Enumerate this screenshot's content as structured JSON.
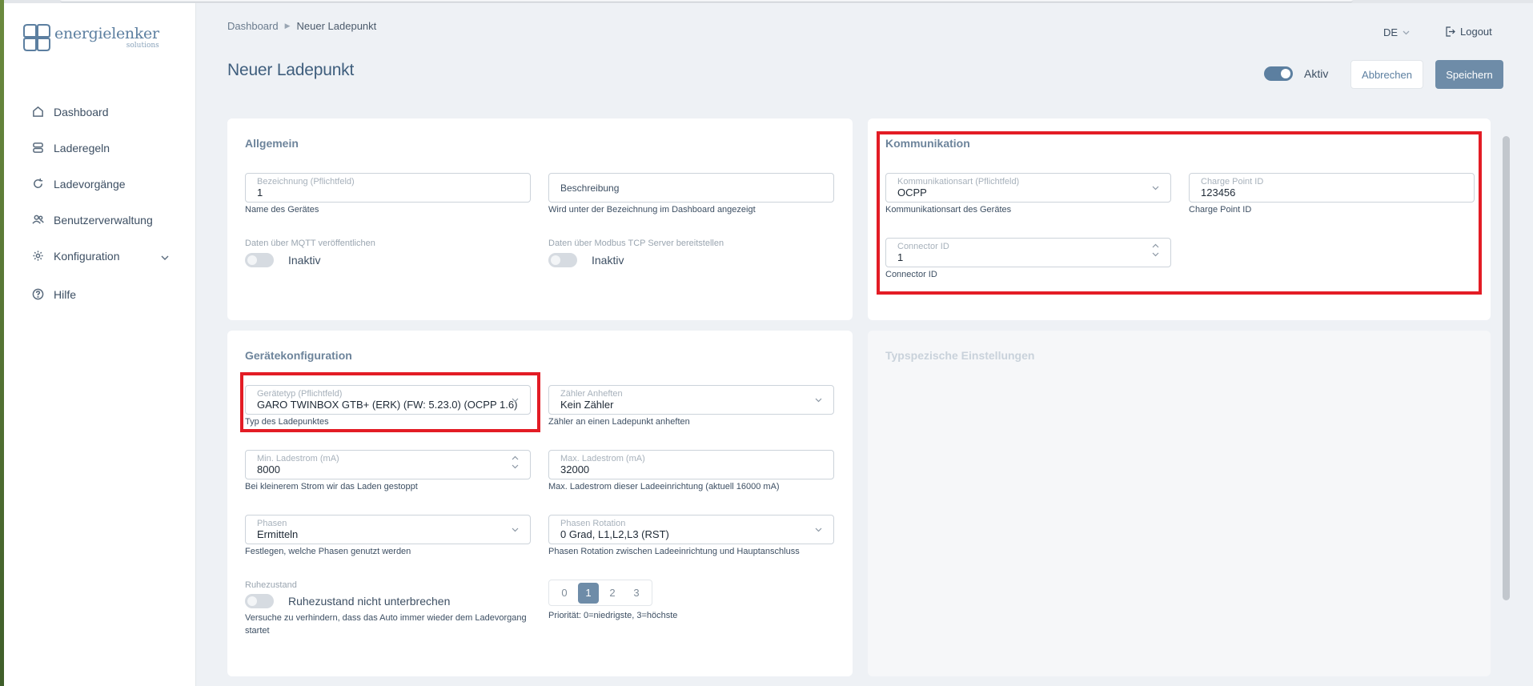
{
  "brand": {
    "name": "energielenker",
    "sub": "solutions"
  },
  "nav": {
    "items": [
      {
        "label": "Dashboard",
        "icon": "home-icon"
      },
      {
        "label": "Laderegeln",
        "icon": "server-icon"
      },
      {
        "label": "Ladevorgänge",
        "icon": "refresh-icon"
      },
      {
        "label": "Benutzerverwaltung",
        "icon": "users-icon"
      },
      {
        "label": "Konfiguration",
        "icon": "gear-icon"
      },
      {
        "label": "Hilfe",
        "icon": "help-icon"
      }
    ]
  },
  "breadcrumb": {
    "root": "Dashboard",
    "current": "Neuer Ladepunkt"
  },
  "page": {
    "title": "Neuer Ladepunkt"
  },
  "header": {
    "language": "DE",
    "logout": "Logout",
    "active_label": "Aktiv",
    "cancel": "Abbrechen",
    "save": "Speichern"
  },
  "allgemein": {
    "title": "Allgemein",
    "bezeichnung": {
      "label": "Bezeichnung (Pflichtfeld)",
      "value": "1",
      "hint": "Name des Gerätes"
    },
    "beschreibung": {
      "placeholder": "Beschreibung",
      "hint": "Wird unter der Bezeichnung im Dashboard angezeigt"
    },
    "mqtt": {
      "label": "Daten über MQTT veröffentlichen",
      "state": "Inaktiv"
    },
    "modbus": {
      "label": "Daten über Modbus TCP Server bereitstellen",
      "state": "Inaktiv"
    }
  },
  "kommunikation": {
    "title": "Kommunikation",
    "art": {
      "label": "Kommunikationsart (Pflichtfeld)",
      "value": "OCPP",
      "hint": "Kommunikationsart des Gerätes"
    },
    "charge_point": {
      "label": "Charge Point ID",
      "value": "123456",
      "hint": "Charge Point ID"
    },
    "connector": {
      "label": "Connector ID",
      "value": "1",
      "hint": "Connector ID"
    }
  },
  "geraetekonfiguration": {
    "title": "Gerätekonfiguration",
    "geraetetyp": {
      "label": "Gerätetyp (Pflichtfeld)",
      "value": "GARO TWINBOX GTB+ (ERK) (FW: 5.23.0) (OCPP 1.6)",
      "hint": "Typ des Ladepunktes"
    },
    "zaehler": {
      "label": "Zähler Anheften",
      "value": "Kein Zähler",
      "hint": "Zähler an einen Ladepunkt anheften"
    },
    "min_strom": {
      "label": "Min. Ladestrom (mA)",
      "value": "8000",
      "hint": "Bei kleinerem Strom wir das Laden gestoppt"
    },
    "max_strom": {
      "label": "Max. Ladestrom (mA)",
      "value": "32000",
      "hint": "Max. Ladestrom dieser Ladeeinrichtung (aktuell 16000 mA)"
    },
    "phasen": {
      "label": "Phasen",
      "value": "Ermitteln",
      "hint": "Festlegen, welche Phasen genutzt werden"
    },
    "rotation": {
      "label": "Phasen Rotation",
      "value": "0 Grad, L1,L2,L3 (RST)",
      "hint": "Phasen Rotation zwischen Ladeeinrichtung und Hauptanschluss"
    },
    "ruhezustand": {
      "label": "Ruhezustand",
      "state": "Ruhezustand nicht unterbrechen",
      "hint": "Versuche zu verhindern, dass das Auto immer wieder dem Ladevorgang startet"
    },
    "prioritaet": {
      "options": [
        "0",
        "1",
        "2",
        "3"
      ],
      "selected": 1,
      "hint": "Priorität: 0=niedrigste, 3=höchste"
    }
  },
  "typspezifisch": {
    "title": "Typspezische Einstellungen"
  },
  "colors": {
    "accent": "#6e8ca8",
    "highlight": "#e31c25"
  }
}
